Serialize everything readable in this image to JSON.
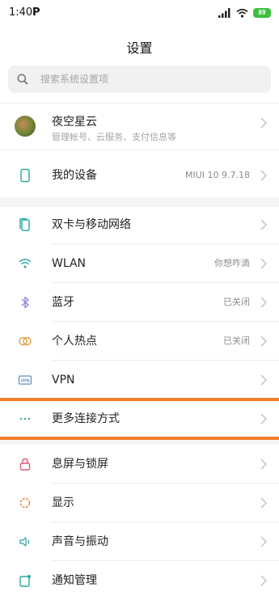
{
  "status": {
    "time": "1:40",
    "p_icon": "P",
    "battery": "89"
  },
  "header": {
    "title": "设置"
  },
  "search": {
    "placeholder": "搜索系统设置项"
  },
  "account": {
    "name": "夜空星云",
    "subtitle": "管理帐号、云服务、支付信息等"
  },
  "device": {
    "label": "我的设备",
    "value": "MIUI 10 9.7.18"
  },
  "network": {
    "items": [
      {
        "label": "双卡与移动网络",
        "icon": "sim-card-icon"
      },
      {
        "label": "WLAN",
        "value": "你想咋滴",
        "icon": "wifi-icon"
      },
      {
        "label": "蓝牙",
        "value": "已关闭",
        "icon": "bluetooth-icon"
      },
      {
        "label": "个人热点",
        "value": "已关闭",
        "icon": "hotspot-icon"
      },
      {
        "label": "VPN",
        "icon": "vpn-icon"
      },
      {
        "label": "更多连接方式",
        "icon": "more-dots-icon"
      }
    ]
  },
  "system": {
    "items": [
      {
        "label": "息屏与锁屏",
        "icon": "lock-icon"
      },
      {
        "label": "显示",
        "icon": "display-icon"
      },
      {
        "label": "声音与振动",
        "icon": "sound-icon"
      },
      {
        "label": "通知管理",
        "icon": "notification-icon"
      }
    ]
  },
  "colors": {
    "highlight": "#f07d2c",
    "icon_teal": "#2aa8a0",
    "battery": "#3dbf3d"
  }
}
